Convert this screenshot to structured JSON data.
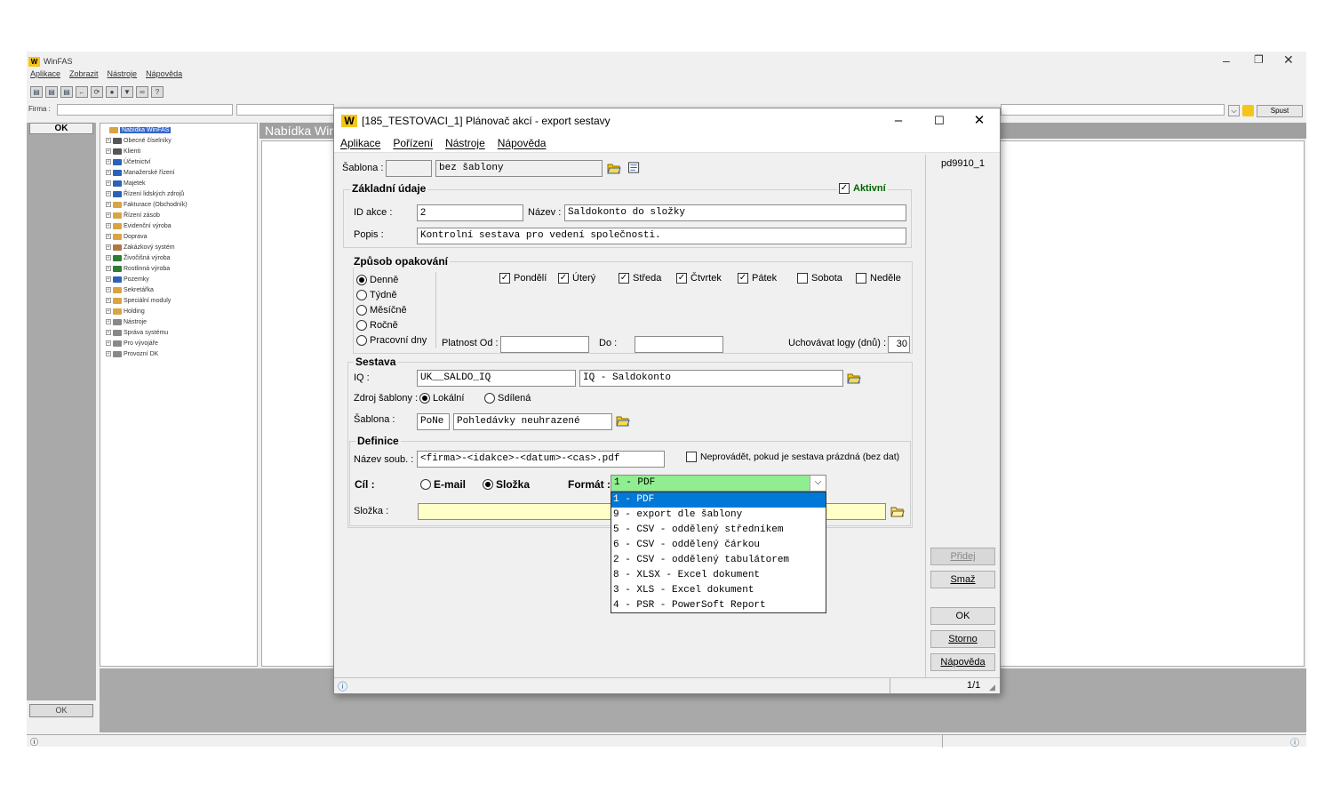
{
  "bg_app": {
    "title": "WinFAS",
    "menu": [
      "Aplikace",
      "Zobrazit",
      "Nástroje",
      "Nápověda"
    ],
    "firma_label": "Firma :",
    "ok_label": "OK",
    "ok_label_bottom": "OK",
    "spust_label": "Spust",
    "nabidka_title": "Nabídka WinFAS",
    "tree": [
      {
        "label": "Nabídka WinFAS",
        "color": "#d9a441"
      },
      {
        "label": "Obecné číselníky",
        "color": "#555555"
      },
      {
        "label": "Klienti",
        "color": "#555555"
      },
      {
        "label": "Účetnictví",
        "color": "#2a62b8"
      },
      {
        "label": "Manažerské řízení",
        "color": "#2a62b8"
      },
      {
        "label": "Majetek",
        "color": "#2a62b8"
      },
      {
        "label": "Řízení lidských zdrojů",
        "color": "#2a62b8"
      },
      {
        "label": "Fakturace (Obchodník)",
        "color": "#d9a441"
      },
      {
        "label": "Řízení zásob",
        "color": "#d9a441"
      },
      {
        "label": "Evidenční výroba",
        "color": "#d9a441"
      },
      {
        "label": "Doprava",
        "color": "#d9a441"
      },
      {
        "label": "Zakázkový systém",
        "color": "#b07840"
      },
      {
        "label": "Živočišná výroba",
        "color": "#2e7d32"
      },
      {
        "label": "Rostlinná výroba",
        "color": "#2e7d32"
      },
      {
        "label": "Pozemky",
        "color": "#2a62b8"
      },
      {
        "label": "Sekretářka",
        "color": "#d9a441"
      },
      {
        "label": "Speciální moduly",
        "color": "#d9a441"
      },
      {
        "label": "Holding",
        "color": "#d9a441"
      },
      {
        "label": "Nástroje",
        "color": "#888888"
      },
      {
        "label": "Správa systému",
        "color": "#888888"
      },
      {
        "label": "Pro vývojáře",
        "color": "#888888"
      },
      {
        "label": "Provozní DK",
        "color": "#888888"
      }
    ]
  },
  "dialog": {
    "title": "[185_TESTOVACI_1] Plánovač akcí - export sestavy",
    "menu": [
      "Aplikace",
      "Pořízení",
      "Nástroje",
      "Nápověda"
    ],
    "side_id": "pd9910_1",
    "sablona_label": "Šablona :",
    "sablona_value": "bez šablony",
    "zakladni": {
      "title": "Základní údaje",
      "aktivni_label": "Aktivní",
      "id_label": "ID akce :",
      "id_value": "2",
      "nazev_label": "Název :",
      "nazev_value": "Saldokonto do složky",
      "popis_label": "Popis :",
      "popis_value": "Kontrolní sestava pro vedení společnosti."
    },
    "opakovani": {
      "title": "Způsob opakování",
      "radios": [
        "Denně",
        "Týdně",
        "Měsíčně",
        "Ročně",
        "Pracovní dny"
      ],
      "days": [
        {
          "label": "Pondělí",
          "checked": true
        },
        {
          "label": "Úterý",
          "checked": true
        },
        {
          "label": "Středa",
          "checked": true
        },
        {
          "label": "Čtvrtek",
          "checked": true
        },
        {
          "label": "Pátek",
          "checked": true
        },
        {
          "label": "Sobota",
          "checked": false
        },
        {
          "label": "Neděle",
          "checked": false
        }
      ],
      "platnost_label": "Platnost Od :",
      "do_label": "Do :",
      "logy_label": "Uchovávat logy (dnů) :",
      "logy_value": "30"
    },
    "sestava": {
      "title": "Sestava",
      "iq_label": "IQ :",
      "iq_code": "UK__SALDO_IQ",
      "iq_name": "IQ - Saldokonto",
      "zdroj_label": "Zdroj šablony :",
      "zdroj_lokalni": "Lokální",
      "zdroj_sdilena": "Sdílená",
      "sablona_label": "Šablona :",
      "sablona_code": "PoNe",
      "sablona_name": "Pohledávky neuhrazené"
    },
    "definice": {
      "title": "Definice",
      "nazev_label": "Název soub. :",
      "nazev_value": "<firma>-<idakce>-<datum>-<cas>.pdf",
      "neprovadet_label": "Neprovádět, pokud je sestava prázdná (bez dat)",
      "cil_label": "Cíl :",
      "email_label": "E-mail",
      "slozka_radio_label": "Složka",
      "format_label": "Formát :",
      "format_value": "1 - PDF",
      "slozka_label": "Složka :",
      "slozka_value": ""
    },
    "format_options": [
      "1 - PDF",
      "9 - export dle šablony",
      "5 - CSV - oddělený středníkem",
      "6 - CSV - oddělený čárkou",
      "2 - CSV - oddělený tabulátorem",
      "8 - XLSX - Excel dokument",
      "3 - XLS - Excel dokument",
      "4 - PSR - PowerSoft Report"
    ],
    "buttons": {
      "pridej": "Přidej",
      "smaz": "Smaž",
      "ok": "OK",
      "storno": "Storno",
      "napoveda": "Nápověda"
    },
    "status_page": "1/1"
  },
  "colors": {
    "format_select_bg": "#90ee90",
    "slozka_field_bg": "#ffffc8",
    "aktivni_color": "#006400",
    "selection_blue": "#0078d7"
  }
}
